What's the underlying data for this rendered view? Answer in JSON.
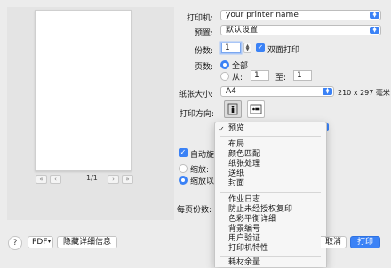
{
  "preview": {
    "page_indicator": "1/1"
  },
  "printer": {
    "label": "打印机:",
    "value": "your printer name"
  },
  "presets": {
    "label": "预置:",
    "value": "默认设置"
  },
  "copies": {
    "label": "份数:",
    "value": "1",
    "duplex_label": "双面打印"
  },
  "pages": {
    "label": "页数:",
    "all_label": "全部",
    "from_label": "从:",
    "from_value": "1",
    "to_label": "至:",
    "to_value": "1"
  },
  "paper_size": {
    "label": "纸张大小:",
    "value": "A4",
    "dimensions": "210 x 297 毫米"
  },
  "orientation": {
    "label": "打印方向:"
  },
  "panel_fragments": {
    "auto_rotate": "自动旋转",
    "scale": "缩放:",
    "scale_to_fit": "缩放以适",
    "pages_per_sheet": "每页份数:"
  },
  "menu": {
    "selected": "预览",
    "group1": [
      "布局",
      "颜色匹配",
      "纸张处理",
      "送纸",
      "封面"
    ],
    "group2": [
      "作业日志",
      "防止未经授权复印",
      "色彩平衡详细",
      "背景编号",
      "用户验证",
      "打印机特性"
    ],
    "group3": [
      "耗材余量"
    ]
  },
  "bottom": {
    "help": "?",
    "pdf_label": "PDF",
    "hide_details": "隐藏详细信息",
    "cancel": "取消",
    "print": "打印"
  },
  "colors": {
    "accent": "#3b82f6"
  }
}
